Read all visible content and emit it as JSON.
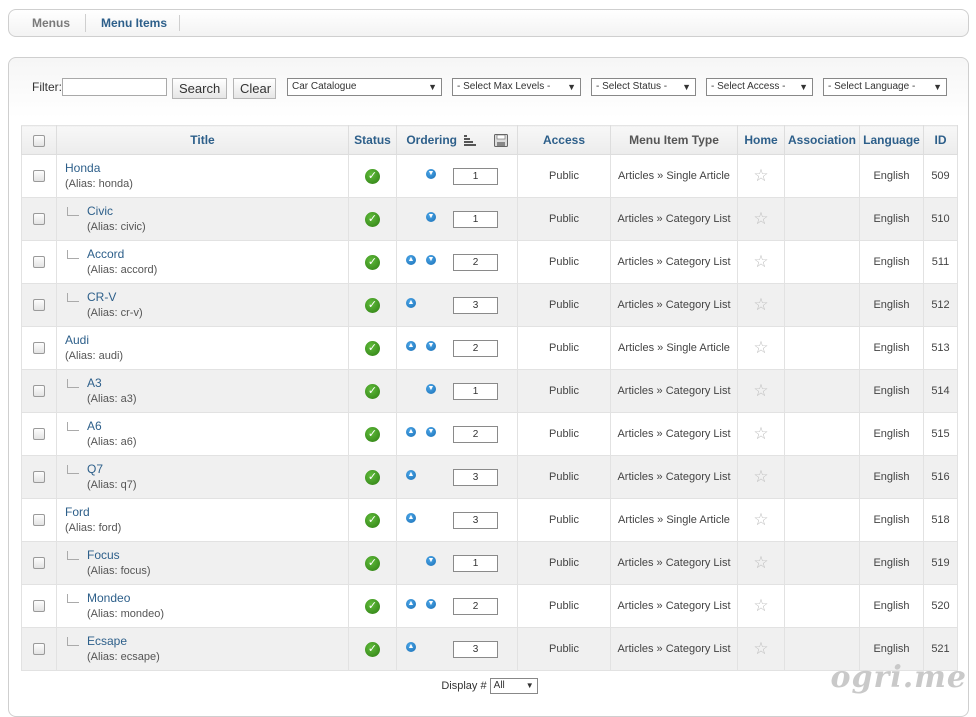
{
  "submenu": {
    "tabs": [
      {
        "label": "Menus"
      },
      {
        "label": "Menu Items"
      }
    ]
  },
  "filter": {
    "label": "Filter:",
    "value": "",
    "search_label": "Search",
    "clear_label": "Clear"
  },
  "selects": {
    "menu": "Car Catalogue",
    "max_levels": "- Select Max Levels -",
    "status": "- Select Status -",
    "access": "- Select Access -",
    "language": "- Select Language -"
  },
  "columns": {
    "title": "Title",
    "status": "Status",
    "ordering": "Ordering",
    "access": "Access",
    "type": "Menu Item Type",
    "home": "Home",
    "association": "Association",
    "language": "Language",
    "id": "ID"
  },
  "alias_prefix": "(Alias:",
  "rows": [
    {
      "title": "Honda",
      "alias": "honda)",
      "level": 1,
      "up": false,
      "down": true,
      "order": "1",
      "access": "Public",
      "type": "Articles » Single Article",
      "language": "English",
      "id": "509"
    },
    {
      "title": "Civic",
      "alias": "civic)",
      "level": 2,
      "up": false,
      "down": true,
      "order": "1",
      "access": "Public",
      "type": "Articles » Category List",
      "language": "English",
      "id": "510"
    },
    {
      "title": "Accord",
      "alias": "accord)",
      "level": 2,
      "up": true,
      "down": true,
      "order": "2",
      "access": "Public",
      "type": "Articles » Category List",
      "language": "English",
      "id": "511"
    },
    {
      "title": "CR-V",
      "alias": "cr-v)",
      "level": 2,
      "up": true,
      "down": false,
      "order": "3",
      "access": "Public",
      "type": "Articles » Category List",
      "language": "English",
      "id": "512"
    },
    {
      "title": "Audi",
      "alias": "audi)",
      "level": 1,
      "up": true,
      "down": true,
      "order": "2",
      "access": "Public",
      "type": "Articles » Single Article",
      "language": "English",
      "id": "513"
    },
    {
      "title": "A3",
      "alias": "a3)",
      "level": 2,
      "up": false,
      "down": true,
      "order": "1",
      "access": "Public",
      "type": "Articles » Category List",
      "language": "English",
      "id": "514"
    },
    {
      "title": "A6",
      "alias": "a6)",
      "level": 2,
      "up": true,
      "down": true,
      "order": "2",
      "access": "Public",
      "type": "Articles » Category List",
      "language": "English",
      "id": "515"
    },
    {
      "title": "Q7",
      "alias": "q7)",
      "level": 2,
      "up": true,
      "down": false,
      "order": "3",
      "access": "Public",
      "type": "Articles » Category List",
      "language": "English",
      "id": "516"
    },
    {
      "title": "Ford",
      "alias": "ford)",
      "level": 1,
      "up": true,
      "down": false,
      "order": "3",
      "access": "Public",
      "type": "Articles » Single Article",
      "language": "English",
      "id": "518"
    },
    {
      "title": "Focus",
      "alias": "focus)",
      "level": 2,
      "up": false,
      "down": true,
      "order": "1",
      "access": "Public",
      "type": "Articles » Category List",
      "language": "English",
      "id": "519"
    },
    {
      "title": "Mondeo",
      "alias": "mondeo)",
      "level": 2,
      "up": true,
      "down": true,
      "order": "2",
      "access": "Public",
      "type": "Articles » Category List",
      "language": "English",
      "id": "520"
    },
    {
      "title": "Ecsape",
      "alias": "ecsape)",
      "level": 2,
      "up": true,
      "down": false,
      "order": "3",
      "access": "Public",
      "type": "Articles » Category List",
      "language": "English",
      "id": "521"
    }
  ],
  "footer": {
    "display_label": "Display #",
    "display_value": "All"
  },
  "watermark": "ogri.me",
  "icons": {
    "status": "published-check-icon",
    "order_up": "arrow-up-icon",
    "order_down": "arrow-down-icon",
    "home": "star-icon",
    "sort": "sort-icon",
    "save_order": "save-icon"
  },
  "colors": {
    "link": "#2d5f8a",
    "published": "#3f9a1f",
    "order_arrow": "#1a6fb5"
  }
}
